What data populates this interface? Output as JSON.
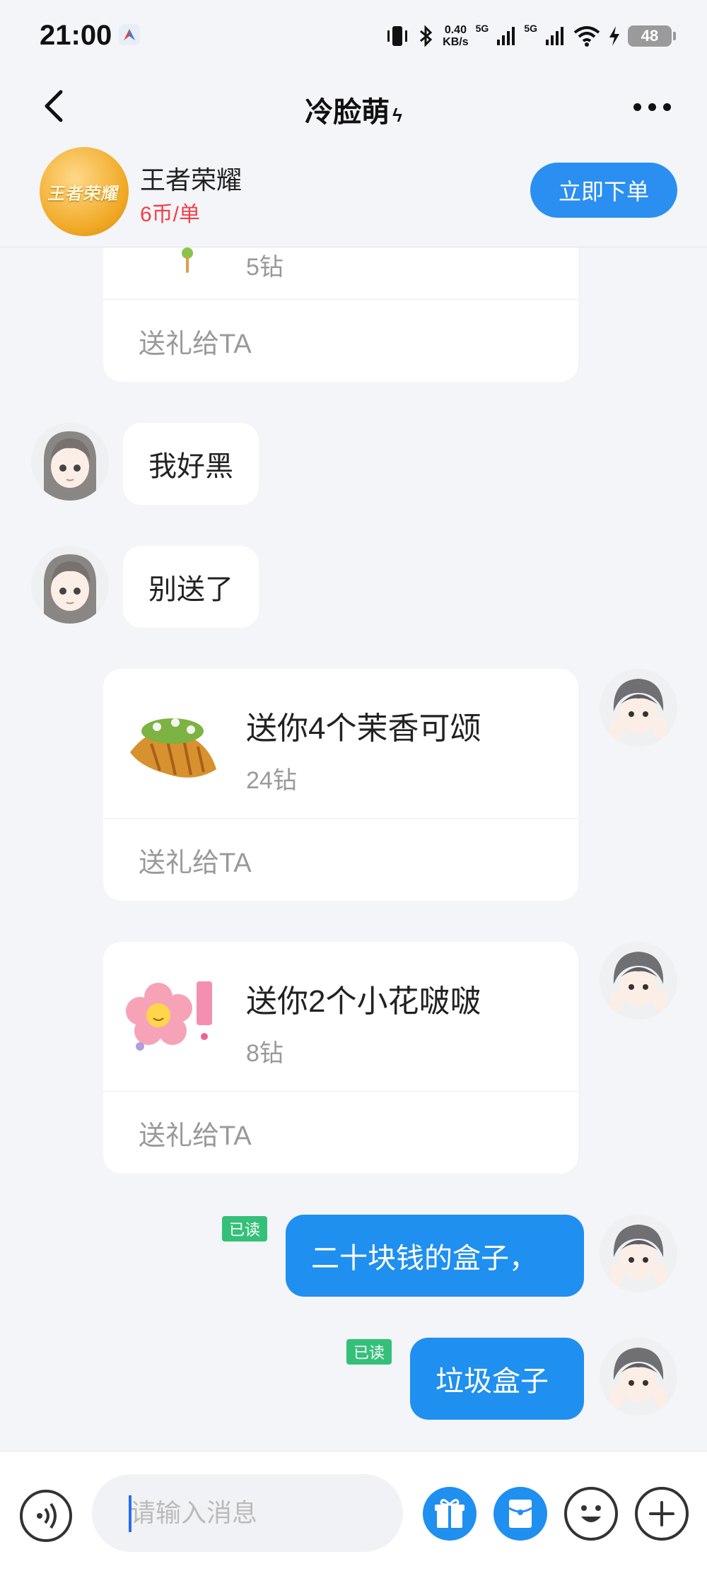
{
  "status_bar": {
    "time": "21:00",
    "net_speed_value": "0.40",
    "net_speed_unit": "KB/s",
    "signal_label_1": "5G",
    "signal_label_2": "5G",
    "battery": "48"
  },
  "header": {
    "title": "冷脸萌",
    "title_symbol": "ϟ"
  },
  "service": {
    "logo_text": "王者荣耀",
    "game_name": "王者荣耀",
    "price": "6币/单",
    "order_button": "立即下单"
  },
  "messages": {
    "gift_partial": {
      "price": "5钻",
      "action": "送礼给TA"
    },
    "msg1": "我好黑",
    "msg2": "别送了",
    "gift1": {
      "title": "送你4个茉香可颂",
      "price": "24钻",
      "action": "送礼给TA"
    },
    "gift2": {
      "title": "送你2个小花啵啵",
      "price": "8钻",
      "action": "送礼给TA"
    },
    "out1": {
      "text": "二十块钱的盒子，",
      "read": "已读"
    },
    "out2": {
      "text": "垃圾盒子",
      "read": "已读"
    }
  },
  "input": {
    "placeholder": "请输入消息"
  },
  "colors": {
    "accent": "#1f8ff0",
    "price_red": "#f0404a",
    "read_green": "#35c07a"
  }
}
